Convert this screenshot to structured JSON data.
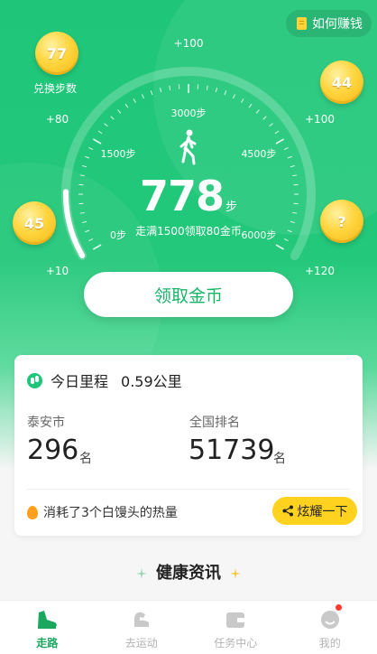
{
  "header": {
    "earn_label": "如何赚钱",
    "earn_icon": "document-icon"
  },
  "coins": {
    "left_top": {
      "value": "77",
      "caption": "兑换步数"
    },
    "left_mid": {
      "value": "45"
    },
    "right_top": {
      "value": "44"
    },
    "right_mid": {
      "value": "?"
    }
  },
  "gauge": {
    "inner_labels": [
      "0步",
      "1500步",
      "3000步",
      "4500步",
      "6000步"
    ],
    "outer_labels": [
      "+10",
      "+80",
      "+100",
      "+100",
      "+120"
    ],
    "progress": 0.13
  },
  "steps": {
    "count": "778",
    "unit": "步",
    "hint": "走满1500领取80金币"
  },
  "claim_button": "领取金币",
  "card": {
    "mileage_label": "今日里程",
    "mileage_value": "0.59公里",
    "city_label": "泰安市",
    "city_rank": "296",
    "city_unit": "名",
    "nation_label": "全国排名",
    "nation_rank": "51739",
    "nation_unit": "名",
    "calorie_text": "消耗了3个白馒头的热量",
    "share_label": "炫耀一下"
  },
  "health_title": "健康资讯",
  "tabs": [
    {
      "label": "走路",
      "icon": "walking-shoe-icon",
      "active": true
    },
    {
      "label": "去运动",
      "icon": "flexed-arm-icon",
      "active": false
    },
    {
      "label": "任务中心",
      "icon": "wallet-icon",
      "active": false
    },
    {
      "label": "我的",
      "icon": "profile-icon",
      "active": false,
      "badge": true
    }
  ],
  "colors": {
    "brand_green": "#1fc679",
    "coin_gold": "#ffd53e",
    "share_yellow": "#ffd21f",
    "badge_red": "#ff3b30"
  }
}
